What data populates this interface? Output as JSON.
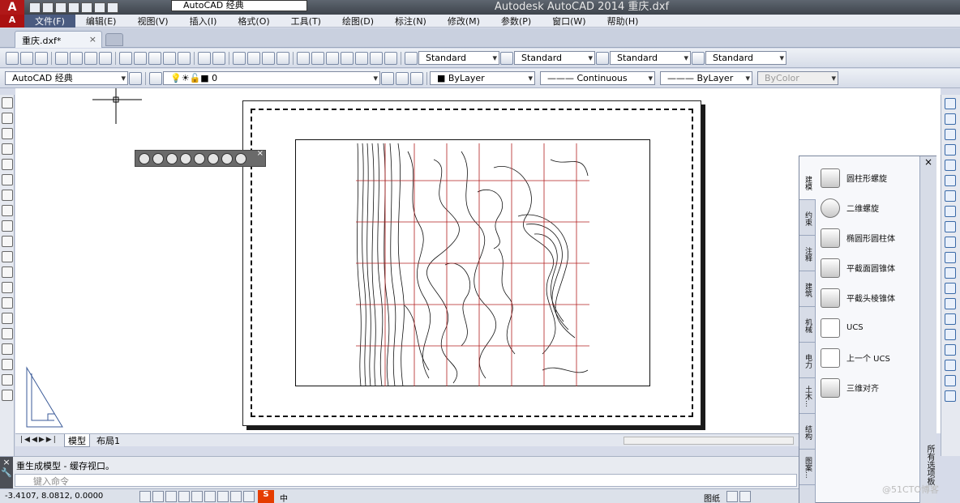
{
  "window": {
    "title": "Autodesk AutoCAD 2014    重庆.dxf",
    "app_logo": "A",
    "workspace": "AutoCAD 经典"
  },
  "menu": [
    "文件(F)",
    "编辑(E)",
    "视图(V)",
    "插入(I)",
    "格式(O)",
    "工具(T)",
    "绘图(D)",
    "标注(N)",
    "修改(M)",
    "参数(P)",
    "窗口(W)",
    "帮助(H)"
  ],
  "document_tab": {
    "name": "重庆.dxf*",
    "close": "×"
  },
  "style_toolbar": {
    "text_style": "Standard",
    "dim_style": "Standard",
    "table_style": "Standard",
    "mleader_style": "Standard"
  },
  "layers_toolbar": {
    "workspace": "AutoCAD 经典",
    "layer": "0",
    "color": "ByLayer",
    "linetype": "Continuous",
    "lineweight": "ByLayer",
    "plotstyle": "ByColor"
  },
  "tool_palette": {
    "tabs": [
      "建模",
      "约束",
      "注释",
      "建筑",
      "机械",
      "电力",
      "土木...",
      "结构",
      "图案..."
    ],
    "items": [
      "圆柱形螺旋",
      "二维螺旋",
      "椭圆形圆柱体",
      "平截面圆锥体",
      "平截头棱锥体",
      "UCS",
      "上一个 UCS",
      "三维对齐"
    ],
    "title": "所有选项板",
    "close": "×"
  },
  "layout_tabs": {
    "nav": "|◀◀▶▶|",
    "model": "模型",
    "layout1": "布局1"
  },
  "command": {
    "history": "重生成模型 - 缓存视口。",
    "placeholder": "键入命令",
    "close": "×"
  },
  "status": {
    "coords": "-3.4107, 8.0812, 0.0000",
    "paper": "图纸",
    "input_method": "中"
  },
  "watermark": "@51CTO博客"
}
